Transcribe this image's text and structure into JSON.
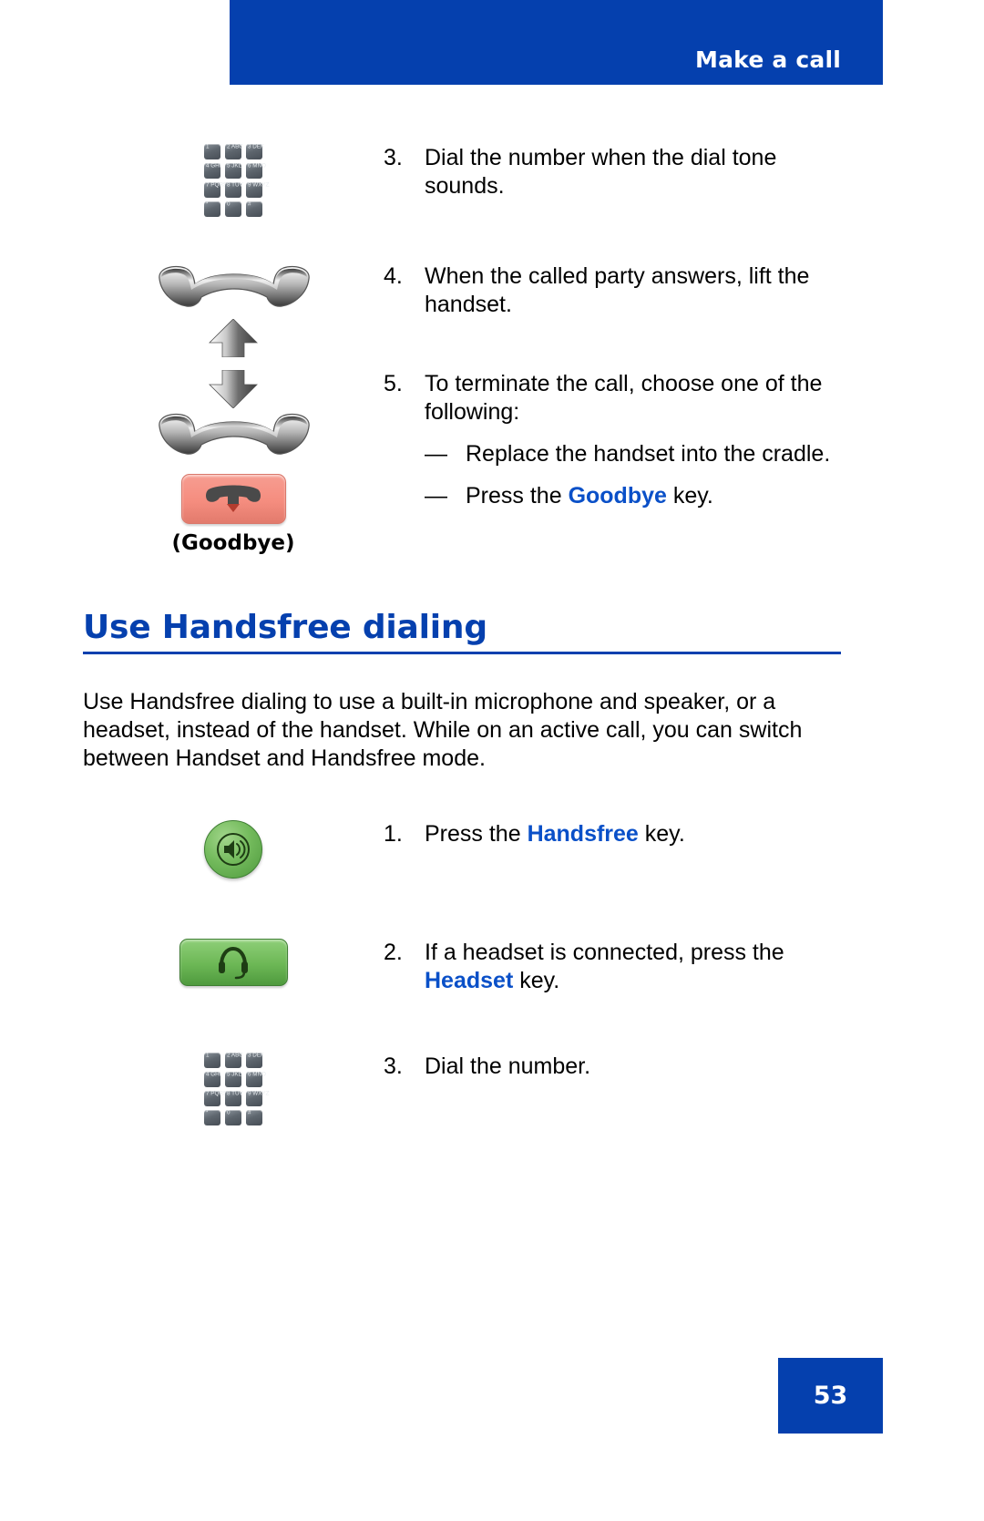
{
  "header": {
    "title": "Make a call",
    "band_color": "#0540AE"
  },
  "colors": {
    "brand_blue": "#0540AE",
    "keyword_blue": "#0A50C8",
    "goodbye_key": "#F58D7F",
    "handsfree_key": "#6CB755"
  },
  "steps_continued": [
    {
      "number": "3.",
      "icon": "dialpad-icon",
      "text": "Dial the number when the dial tone sounds."
    },
    {
      "number": "4.",
      "icon": "handset-lift-icon",
      "text": "When the called party answers, lift the handset."
    },
    {
      "number": "5.",
      "icon": "handset-replace-goodbye-icon",
      "text": "To terminate the call, choose one of the following:",
      "icon_caption": "(Goodbye)",
      "sub_items": [
        {
          "dash": "—",
          "pre": "Replace the handset into the cradle.",
          "keyword": "",
          "post": ""
        },
        {
          "dash": "—",
          "pre": "Press the ",
          "keyword": "Goodbye",
          "post": " key."
        }
      ]
    }
  ],
  "section": {
    "heading": "Use Handsfree dialing",
    "paragraph": "Use Handsfree dialing to use a built-in microphone and speaker, or a headset, instead of the handset. While on an active call, you can switch between Handset and Handsfree mode.",
    "steps": [
      {
        "number": "1.",
        "icon": "handsfree-key-icon",
        "pre": "Press the ",
        "keyword": "Handsfree",
        "post": " key."
      },
      {
        "number": "2.",
        "icon": "headset-key-icon",
        "pre": "If a headset is connected, press the ",
        "keyword": "Headset",
        "post": " key."
      },
      {
        "number": "3.",
        "icon": "dialpad-icon",
        "pre": "Dial the number.",
        "keyword": "",
        "post": ""
      }
    ]
  },
  "keypad": {
    "keys": [
      "1",
      "2 ABC",
      "3 DEF",
      "4 GHI",
      "5 JKL",
      "6 MNO",
      "7 PQRS",
      "8 TUV",
      "9 WXYZ",
      "*",
      "0",
      "#"
    ]
  },
  "footer": {
    "page_number": "53"
  }
}
